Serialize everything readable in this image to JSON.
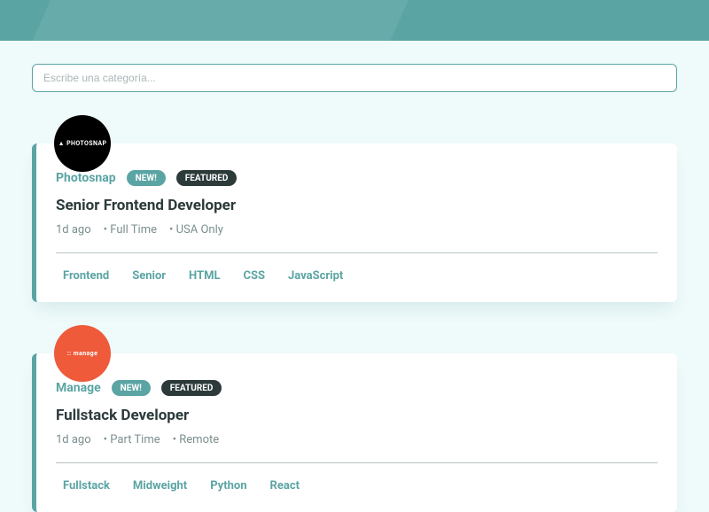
{
  "search": {
    "placeholder": "Escribe una categoría..."
  },
  "jobs": [
    {
      "company": "Photosnap",
      "avatar_label": "▲ PHOTOSNAP",
      "avatar_class": "black",
      "new_label": "NEW!",
      "featured_label": "FEATURED",
      "position": "Senior Frontend Developer",
      "posted": "1d ago",
      "contract": "Full Time",
      "location": "USA Only",
      "tags": [
        "Frontend",
        "Senior",
        "HTML",
        "CSS",
        "JavaScript"
      ]
    },
    {
      "company": "Manage",
      "avatar_label": ":: manage",
      "avatar_class": "orange",
      "new_label": "NEW!",
      "featured_label": "FEATURED",
      "position": "Fullstack Developer",
      "posted": "1d ago",
      "contract": "Part Time",
      "location": "Remote",
      "tags": [
        "Fullstack",
        "Midweight",
        "Python",
        "React"
      ]
    }
  ]
}
